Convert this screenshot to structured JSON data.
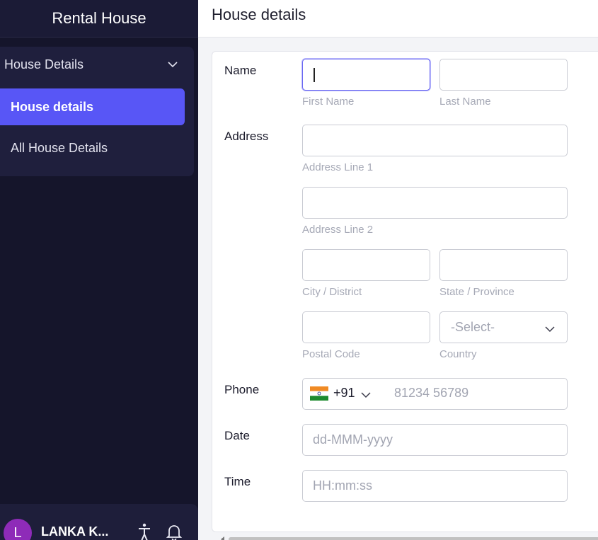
{
  "sidebar": {
    "app_title": "Rental House",
    "group": {
      "label": "House Details",
      "items": [
        {
          "label": "House details",
          "active": true
        },
        {
          "label": "All House Details",
          "active": false
        }
      ]
    },
    "footer": {
      "avatar_initial": "L",
      "user_name": "LANKA K...",
      "avatar_color": "#8e2bb8"
    }
  },
  "header": {
    "title": "House details"
  },
  "form": {
    "name": {
      "label": "Name",
      "first_name": {
        "value": "",
        "sublabel": "First Name"
      },
      "last_name": {
        "value": "",
        "sublabel": "Last Name"
      }
    },
    "address": {
      "label": "Address",
      "line1": {
        "value": "",
        "sublabel": "Address Line 1"
      },
      "line2": {
        "value": "",
        "sublabel": "Address Line 2"
      },
      "city": {
        "value": "",
        "sublabel": "City / District"
      },
      "state": {
        "value": "",
        "sublabel": "State / Province"
      },
      "postal": {
        "value": "",
        "sublabel": "Postal Code"
      },
      "country": {
        "selected": "-Select-",
        "sublabel": "Country"
      }
    },
    "phone": {
      "label": "Phone",
      "dial_code": "+91",
      "flag_icon": "india-flag-icon",
      "placeholder": "81234 56789"
    },
    "date": {
      "label": "Date",
      "placeholder": "dd-MMM-yyyy"
    },
    "time": {
      "label": "Time",
      "placeholder": "HH:mm:ss"
    }
  },
  "colors": {
    "sidebar_bg": "#15152b",
    "accent": "#5856f6",
    "focus_border": "#6a68f2"
  }
}
